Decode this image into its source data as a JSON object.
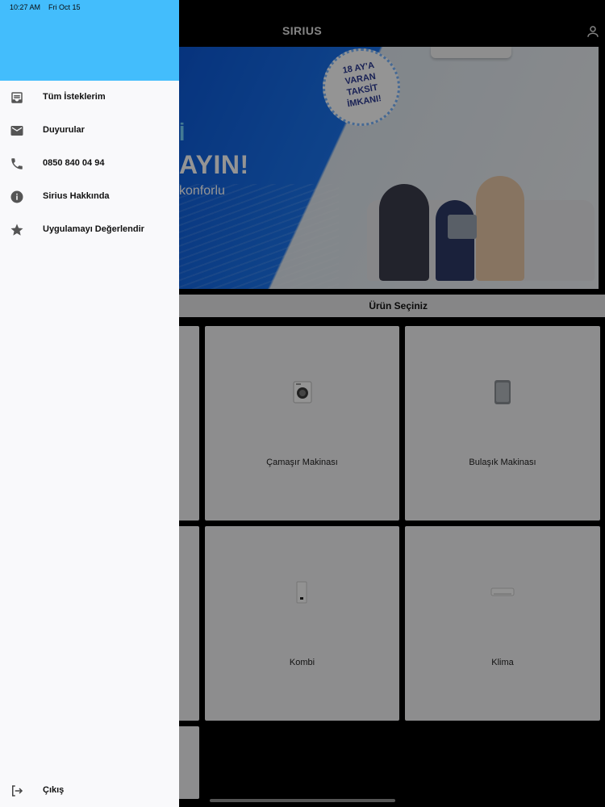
{
  "status_bar": {
    "time": "10:27 AM",
    "date": "Fri Oct 15"
  },
  "app": {
    "title": "SIRIUS",
    "banner": {
      "line1": "İ",
      "line2": "AYIN!",
      "line3": "konforlu",
      "badge": "18 AY'A\nVARAN\nTAKSİT\nİMKANI!"
    },
    "section_title": "Ürün Seçiniz",
    "products": [
      {
        "label": "Çamaşır Makinası",
        "icon": "washing-machine-icon"
      },
      {
        "label": "Bulaşık Makinası",
        "icon": "dishwasher-icon"
      },
      {
        "label": "Kombi",
        "icon": "boiler-icon"
      },
      {
        "label": "Klima",
        "icon": "air-conditioner-icon"
      }
    ]
  },
  "drawer": {
    "header_color": "#43bdfc",
    "items": [
      {
        "label": "Tüm İsteklerim",
        "icon": "inbox-icon"
      },
      {
        "label": "Duyurular",
        "icon": "mail-icon"
      },
      {
        "label": "0850 840 04 94",
        "icon": "phone-icon"
      },
      {
        "label": "Sirius Hakkında",
        "icon": "info-icon"
      },
      {
        "label": "Uygulamayı Değerlendir",
        "icon": "star-icon"
      }
    ],
    "logout": {
      "label": "Çıkış",
      "icon": "logout-icon"
    }
  }
}
